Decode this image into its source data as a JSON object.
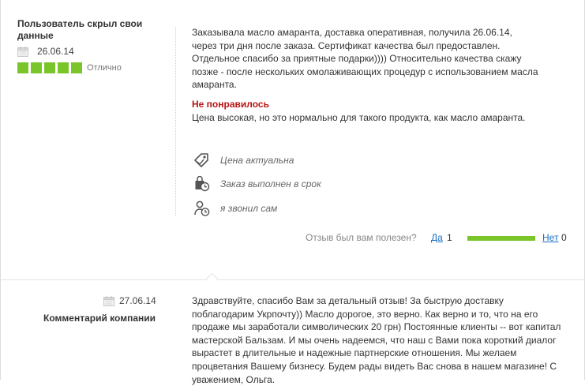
{
  "review": {
    "author": "Пользователь скрыл свои данные",
    "date": "26.06.14",
    "rating": {
      "value": 5,
      "max": 5,
      "label": "Отлично",
      "color": "#7ac62a"
    },
    "text": "Заказывала масло амаранта, доставка оперативная, получила 26.06.14, через три дня после заказа. Сертификат качества был предоставлен. Отдельное спасибо за приятные подарки)))) Относительно качества скажу позже - после нескольких омолаживающих процедур с использованием масла амаранта.",
    "dislike_title": "Не понравилось",
    "dislike_text": "Цена высокая, но это нормально для такого продукта, как масло амаранта.",
    "features": [
      {
        "icon": "price-tag-icon",
        "label": "Цена актуальна"
      },
      {
        "icon": "shopping-bag-clock-icon",
        "label": "Заказ выполнен в срок"
      },
      {
        "icon": "person-clock-icon",
        "label": "я звонил сам"
      }
    ]
  },
  "helpful": {
    "question": "Отзыв был вам полезен?",
    "yes_label": "Да",
    "yes_count": "1",
    "no_label": "Нет",
    "no_count": "0",
    "yes_share": 1.0
  },
  "company_reply": {
    "date": "27.06.14",
    "label": "Комментарий компании",
    "text": "Здравствуйте, спасибо Вам за детальный отзыв! За быструю доставку поблагодарим Укрпочту)) Масло дорогое, это верно. Как верно и то, что на его продаже мы заработали символических 20 грн) Постоянные клиенты -- вот капитал мастерской Бальзам. И мы очень надеемся, что наш с Вами пока короткий диалог вырастет в длительные и надежные партнерские отношения. Мы желаем процветания Вашему бизнесу. Будем рады видеть Вас снова в нашем магазине! С уважением, Ольга."
  },
  "colors": {
    "accent_green": "#7ac62a",
    "link_blue": "#1a6fc0",
    "dislike_red": "#b81414"
  }
}
